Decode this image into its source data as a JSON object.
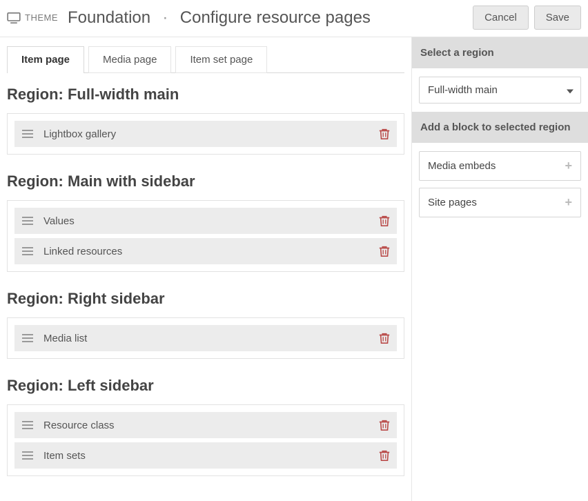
{
  "header": {
    "theme_label": "THEME",
    "theme_name": "Foundation",
    "page_title": "Configure resource pages",
    "cancel_label": "Cancel",
    "save_label": "Save"
  },
  "tabs": [
    {
      "label": "Item page",
      "active": true
    },
    {
      "label": "Media page",
      "active": false
    },
    {
      "label": "Item set page",
      "active": false
    }
  ],
  "regions": [
    {
      "title": "Region: Full-width main",
      "blocks": [
        {
          "label": "Lightbox gallery"
        }
      ]
    },
    {
      "title": "Region: Main with sidebar",
      "blocks": [
        {
          "label": "Values"
        },
        {
          "label": "Linked resources"
        }
      ]
    },
    {
      "title": "Region: Right sidebar",
      "blocks": [
        {
          "label": "Media list"
        }
      ]
    },
    {
      "title": "Region: Left sidebar",
      "blocks": [
        {
          "label": "Resource class"
        },
        {
          "label": "Item sets"
        }
      ]
    }
  ],
  "sidebar": {
    "select_region_heading": "Select a region",
    "selected_region": "Full-width main",
    "add_block_heading": "Add a block to selected region",
    "available_blocks": [
      {
        "label": "Media embeds"
      },
      {
        "label": "Site pages"
      }
    ]
  }
}
